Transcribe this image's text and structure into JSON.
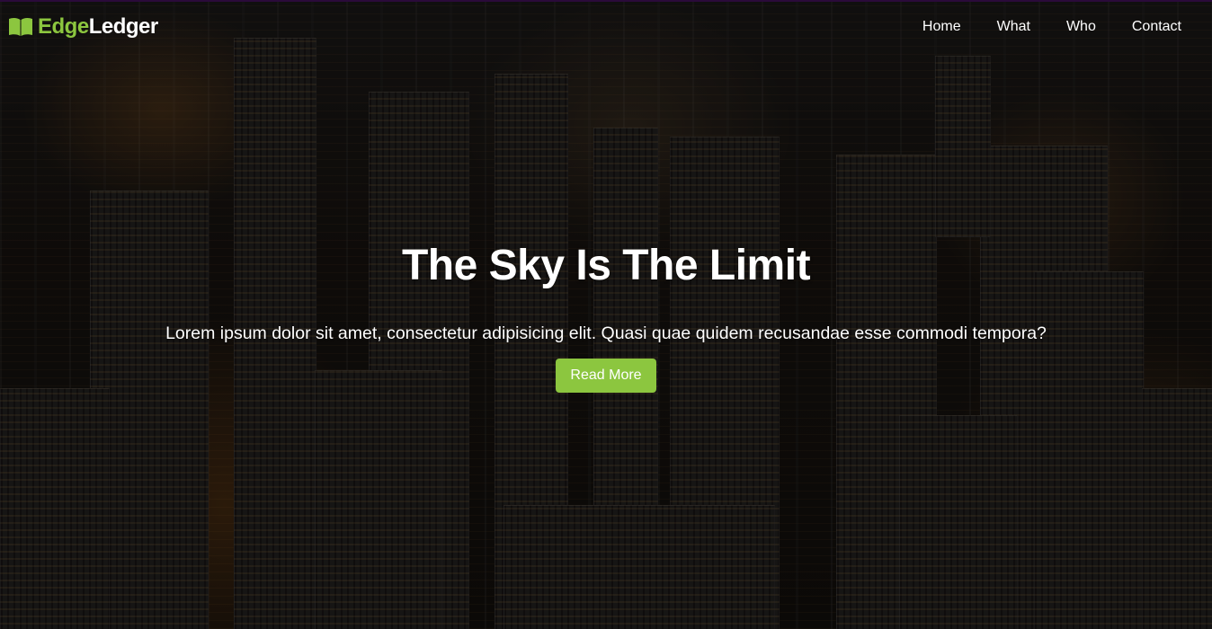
{
  "brand": {
    "edge": "Edge",
    "ledger": "Ledger",
    "icon": "book-icon",
    "accent_color": "#8cc63f"
  },
  "nav": {
    "items": [
      {
        "label": "Home"
      },
      {
        "label": "What"
      },
      {
        "label": "Who"
      },
      {
        "label": "Contact"
      }
    ]
  },
  "hero": {
    "title": "The Sky Is The Limit",
    "text": "Lorem ipsum dolor sit amet, consectetur adipisicing elit. Quasi quae quidem recusandae esse commodi tempora?",
    "button_label": "Read More",
    "button_color": "#8cc63f"
  }
}
